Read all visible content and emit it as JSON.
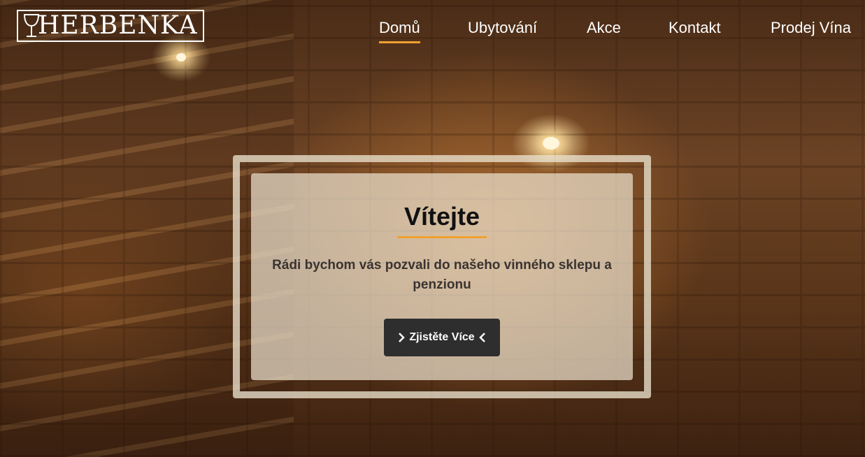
{
  "brand": {
    "logo_text": "HERBENKA"
  },
  "nav": {
    "items": [
      {
        "label": "Domů",
        "active": true
      },
      {
        "label": "Ubytování",
        "active": false
      },
      {
        "label": "Akce",
        "active": false
      },
      {
        "label": "Kontakt",
        "active": false
      },
      {
        "label": "Prodej Vína",
        "active": false
      }
    ]
  },
  "hero": {
    "title": "Vítejte",
    "subtitle": "Rádi bychom vás pozvali do našeho vinného sklepu a penzionu",
    "cta_label": "Zjistěte Více"
  },
  "colors": {
    "accent": "#f0a030",
    "button": "#2e2e2e"
  },
  "icons": {
    "logo": "wine-glass-icon",
    "cta_left": "chevron-right-icon",
    "cta_right": "chevron-left-icon"
  }
}
